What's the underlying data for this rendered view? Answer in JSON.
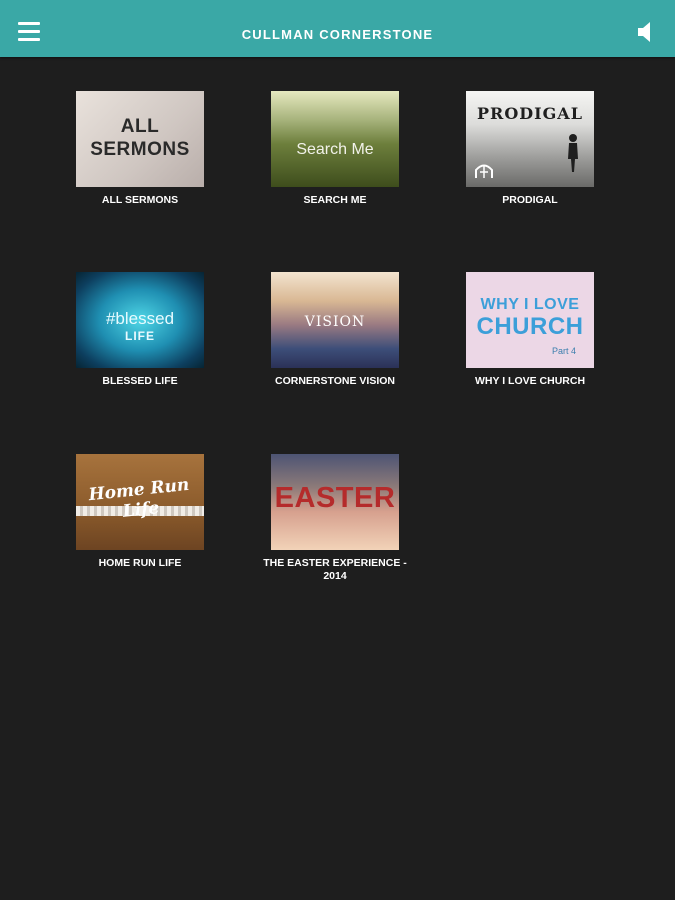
{
  "app": {
    "title": "CULLMAN CORNERSTONE",
    "icons": {
      "menu": "hamburger-menu-icon",
      "sound": "speaker-icon"
    }
  },
  "sermons": [
    {
      "label": "ALL SERMONS",
      "thumb_text": "ALL\nSERMONS"
    },
    {
      "label": "SEARCH ME",
      "thumb_text": "Search Me"
    },
    {
      "label": "PRODIGAL",
      "thumb_text": "PRODIGAL"
    },
    {
      "label": "BLESSED LIFE",
      "thumb_text_1": "#blessed",
      "thumb_text_2": "LIFE"
    },
    {
      "label": "CORNERSTONE VISION",
      "thumb_text": "VISION"
    },
    {
      "label": "WHY I LOVE CHURCH",
      "thumb_text_1": "WHY I LOVE",
      "thumb_text_2": "CHURCH",
      "thumb_text_3": "Part 4"
    },
    {
      "label": "HOME RUN LIFE",
      "thumb_text": "Home Run Life"
    },
    {
      "label": "THE EASTER EXPERIENCE - 2014",
      "thumb_text": "EASTER"
    }
  ],
  "colors": {
    "appbar": "#3aa8a6",
    "background": "#1e1e1e"
  }
}
